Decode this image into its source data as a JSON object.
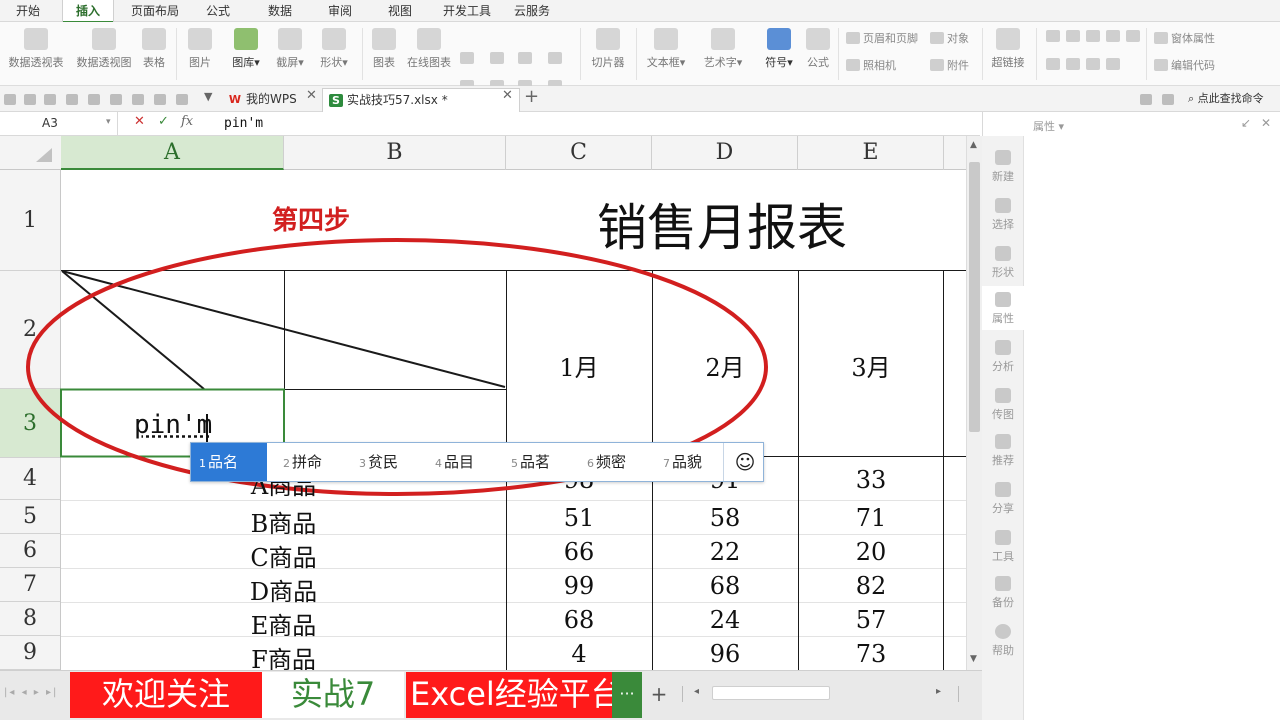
{
  "menu_tabs": [
    "开始",
    "插入",
    "页面布局",
    "公式",
    "数据",
    "审阅",
    "视图",
    "开发工具",
    "云服务"
  ],
  "active_menu_index": 1,
  "ribbon": {
    "large": [
      "数据透视表",
      "数据透视图",
      "表格",
      "图片",
      "图库",
      "截屏",
      "形状",
      "图表",
      "在线图表",
      "切片器",
      "文本框",
      "艺术字",
      "符号",
      "公式",
      "超链接"
    ],
    "small": [
      "页眉和页脚",
      "对象",
      "照相机",
      "附件",
      "窗体属性",
      "编辑代码"
    ]
  },
  "doc_tabs": [
    {
      "label": "我的WPS",
      "icon": "W"
    },
    {
      "label": "实战技巧57.xlsx *",
      "icon": "S"
    }
  ],
  "find_command_label": "点此查找命令",
  "formula_bar": {
    "name_box": "A3",
    "content": "pin'm"
  },
  "columns": [
    "A",
    "B",
    "C",
    "D",
    "E"
  ],
  "selected_column": "A",
  "rows": [
    "1",
    "2",
    "3",
    "4",
    "5",
    "6",
    "7",
    "8",
    "9"
  ],
  "selected_row": "3",
  "sheet": {
    "step_label": "第四步",
    "title": "销售月报表",
    "months": [
      "1月",
      "2月",
      "3月"
    ],
    "editing_text": "pin'm",
    "products": [
      {
        "name": "A商品",
        "values": [
          "98",
          "91",
          "33"
        ]
      },
      {
        "name": "B商品",
        "values": [
          "51",
          "58",
          "71"
        ]
      },
      {
        "name": "C商品",
        "values": [
          "66",
          "22",
          "20"
        ]
      },
      {
        "name": "D商品",
        "values": [
          "99",
          "68",
          "82"
        ]
      },
      {
        "name": "E商品",
        "values": [
          "68",
          "24",
          "57"
        ]
      },
      {
        "name": "F商品",
        "values": [
          "4",
          "96",
          "73"
        ]
      }
    ]
  },
  "ime_candidates": [
    {
      "num": "1",
      "text": "品名"
    },
    {
      "num": "2",
      "text": "拼命"
    },
    {
      "num": "3",
      "text": "贫民"
    },
    {
      "num": "4",
      "text": "品目"
    },
    {
      "num": "5",
      "text": "品茗"
    },
    {
      "num": "6",
      "text": "频密"
    },
    {
      "num": "7",
      "text": "品貌"
    }
  ],
  "ime_emoji": "☺",
  "sheet_tabs": [
    "欢迎关注",
    "实战7",
    "Excel经验平台"
  ],
  "sheet_more": "···",
  "sheet_add": "+",
  "right_panel": {
    "title": "属性 ▾",
    "side_items": [
      "新建",
      "选择",
      "形状",
      "属性",
      "分析",
      "传图",
      "推荐",
      "分享",
      "工具",
      "备份",
      "帮助"
    ]
  },
  "colors": {
    "accent_green": "#3a8a3a",
    "annotation_red": "#d21f1f",
    "sheet_tab_red": "#ff1a1a",
    "ime_blue": "#2d7ad6"
  }
}
